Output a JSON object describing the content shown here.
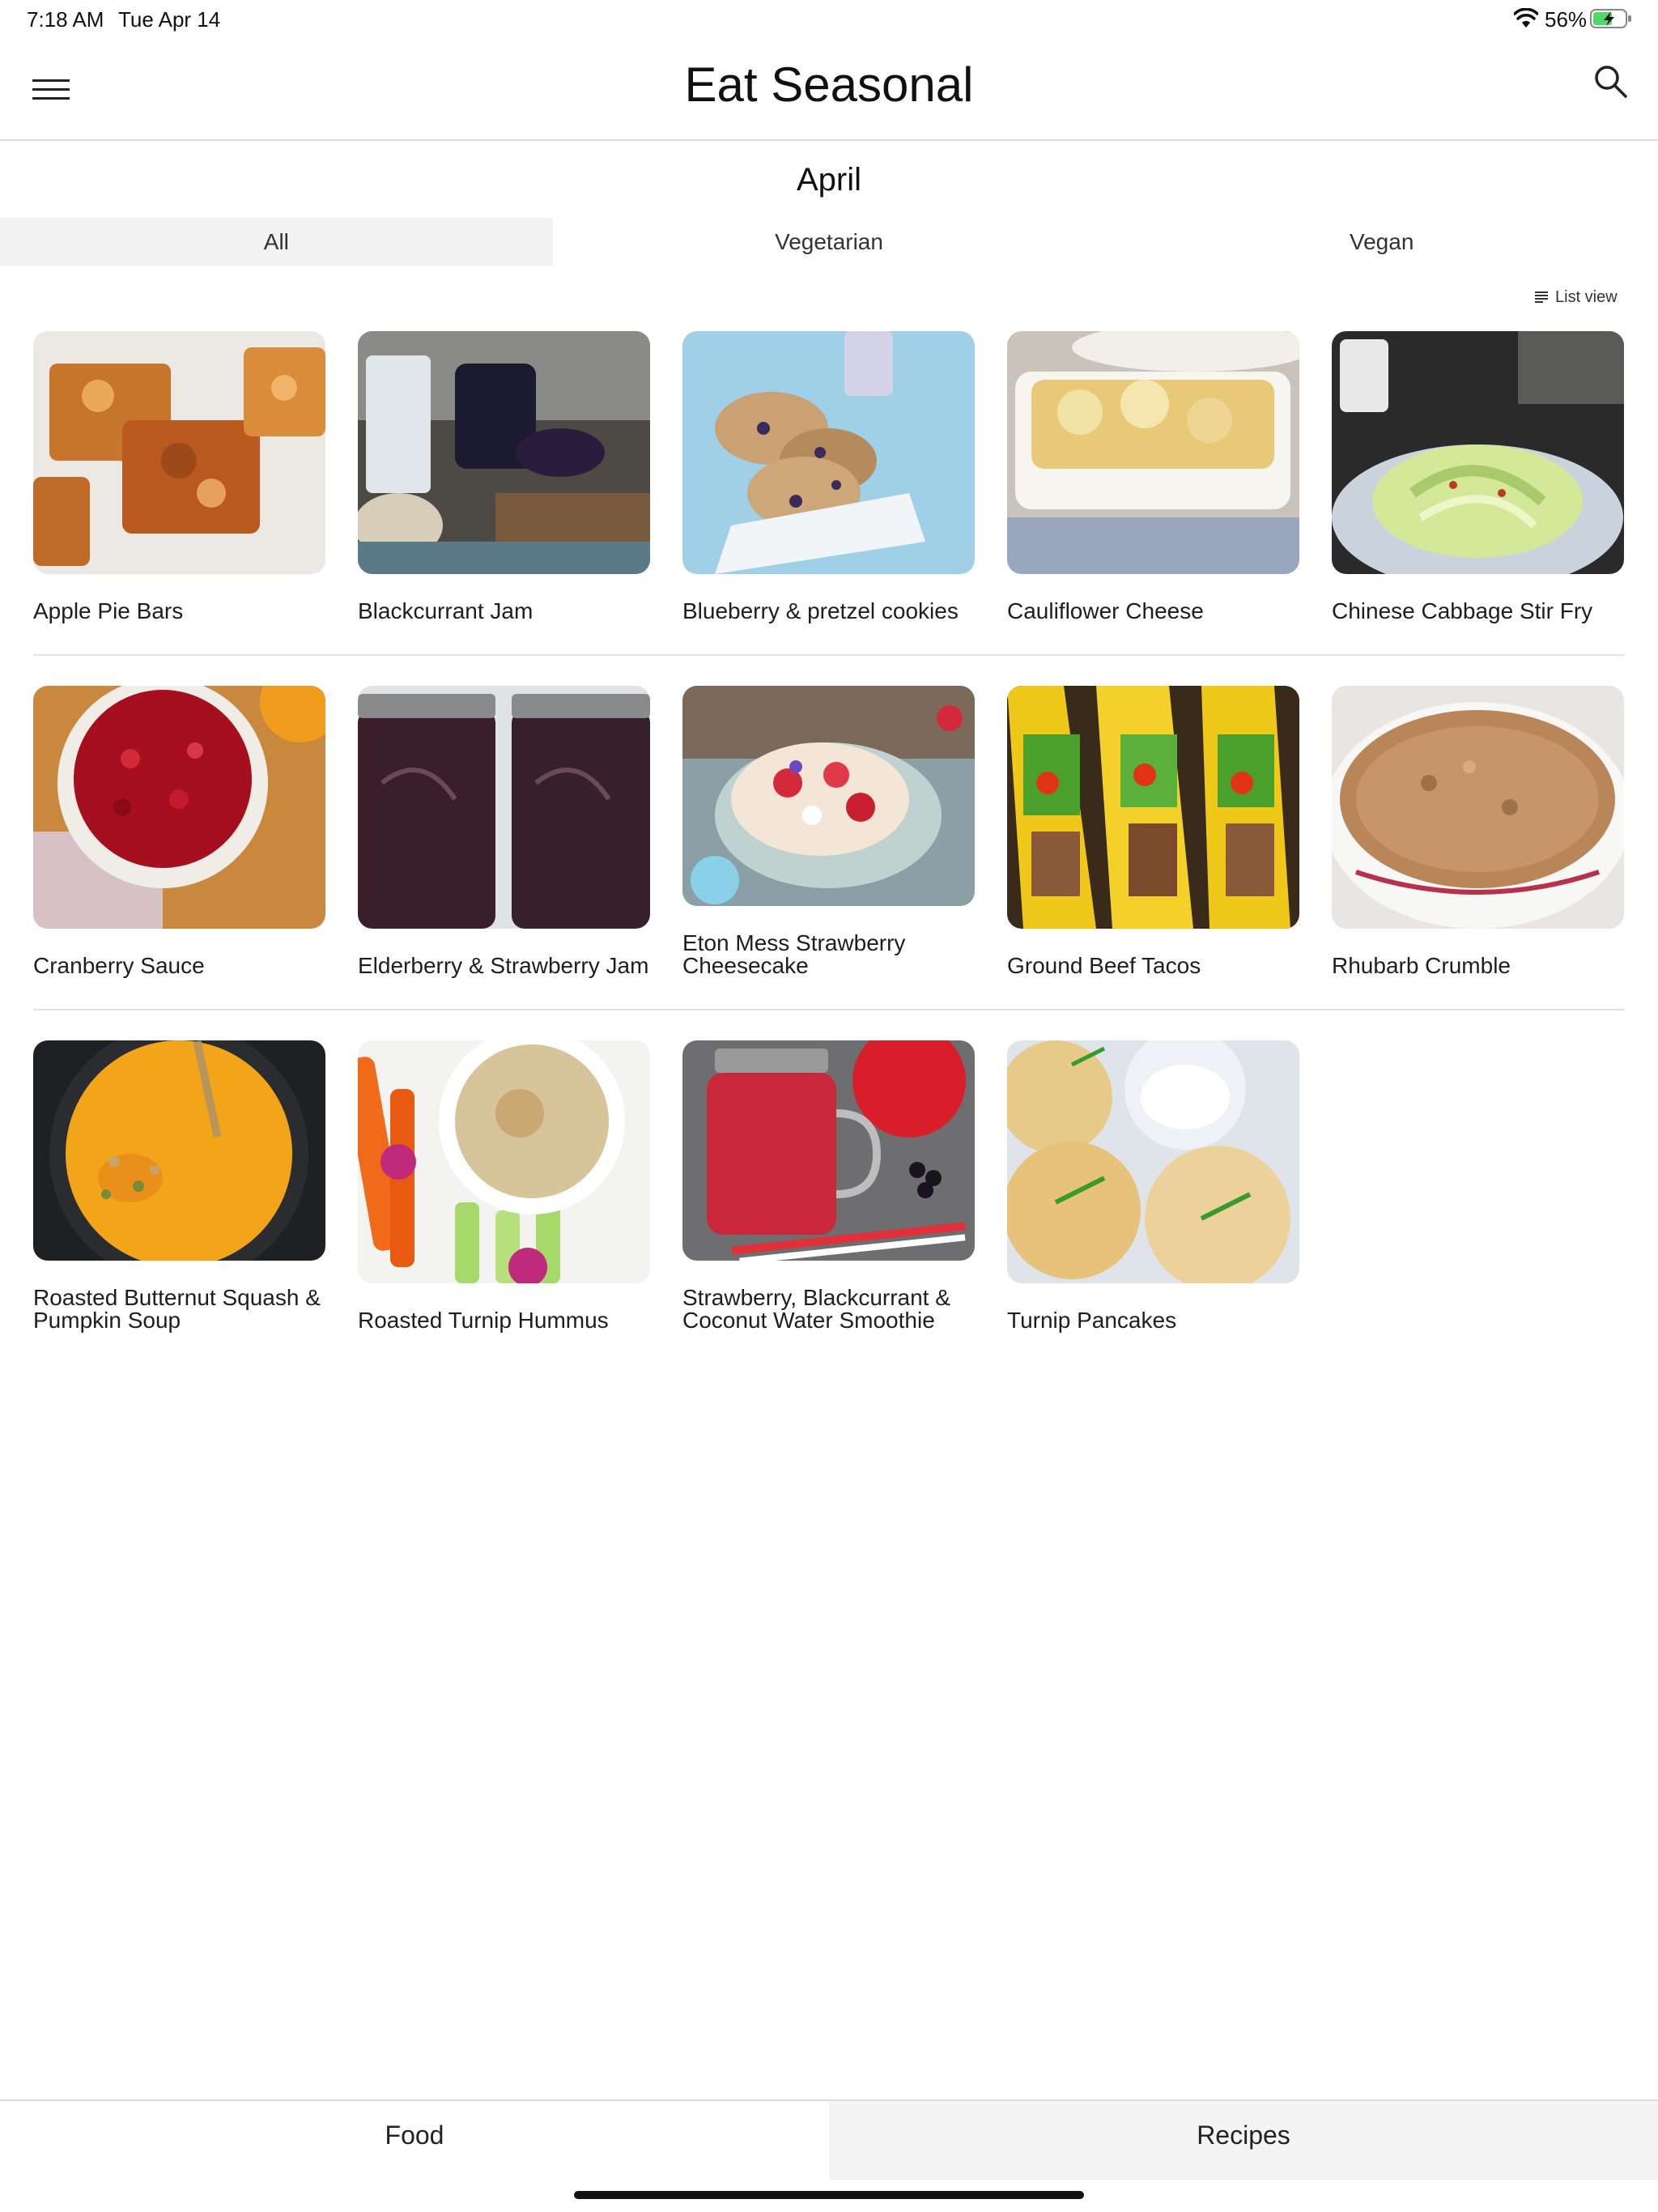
{
  "status": {
    "time": "7:18 AM",
    "date": "Tue Apr 14",
    "battery": "56%"
  },
  "header": {
    "title": "Eat Seasonal",
    "menu_icon": "hamburger-menu-icon",
    "search_icon": "search-icon"
  },
  "month": "April",
  "filters": {
    "tabs": [
      "All",
      "Vegetarian",
      "Vegan"
    ],
    "selected": "All"
  },
  "view_toggle": {
    "label": "List view",
    "icon": "list-icon"
  },
  "recipes": [
    {
      "title": "Apple Pie Bars"
    },
    {
      "title": "Blackcurrant Jam"
    },
    {
      "title": "Blueberry & pretzel cookies"
    },
    {
      "title": "Cauliflower Cheese"
    },
    {
      "title": "Chinese Cabbage Stir Fry"
    },
    {
      "title": "Cranberry Sauce"
    },
    {
      "title": "Elderberry & Strawberry Jam"
    },
    {
      "title": "Eton Mess Strawberry Cheesecake"
    },
    {
      "title": "Ground Beef Tacos"
    },
    {
      "title": "Rhubarb Crumble"
    },
    {
      "title": "Roasted Butternut Squash & Pumpkin Soup"
    },
    {
      "title": "Roasted Turnip Hummus"
    },
    {
      "title": "Strawberry, Blackcurrant & Coconut Water Smoothie"
    },
    {
      "title": "Turnip Pancakes"
    }
  ],
  "bottom_tabs": {
    "food": "Food",
    "recipes": "Recipes",
    "selected": "Food"
  },
  "colors": {
    "accent_selected_tab": "#f2f2f2",
    "divider": "#e2e2e2",
    "battery_charging": "#4cd964"
  }
}
